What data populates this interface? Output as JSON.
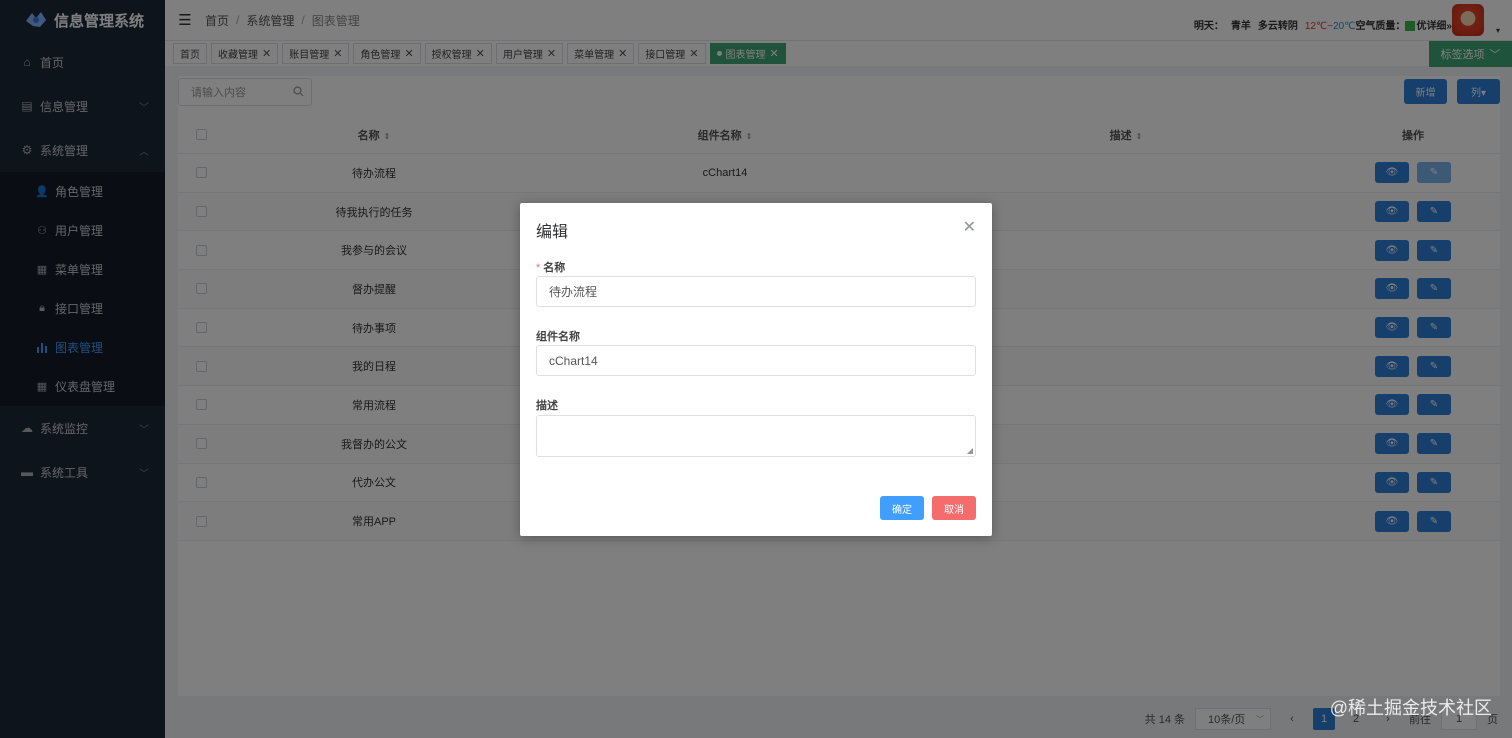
{
  "app": {
    "title": "信息管理系统"
  },
  "sidebar": {
    "items": [
      {
        "label": "首页",
        "icon": "home-icon"
      },
      {
        "label": "信息管理",
        "icon": "info-icon",
        "expandable": true
      },
      {
        "label": "系统管理",
        "icon": "gear-icon",
        "expandable": true,
        "expanded": true
      },
      {
        "label": "系统监控",
        "icon": "monitor-icon",
        "expandable": true
      },
      {
        "label": "系统工具",
        "icon": "tools-icon",
        "expandable": true
      }
    ],
    "system_sub": [
      {
        "label": "角色管理",
        "icon": "user-group-icon"
      },
      {
        "label": "用户管理",
        "icon": "user-icon"
      },
      {
        "label": "菜单管理",
        "icon": "grid-icon"
      },
      {
        "label": "接口管理",
        "icon": "lock-icon"
      },
      {
        "label": "图表管理",
        "icon": "bar-chart-icon",
        "active": true
      },
      {
        "label": "仪表盘管理",
        "icon": "table-icon"
      }
    ]
  },
  "header": {
    "breadcrumb": [
      "首页",
      "系统管理",
      "图表管理"
    ],
    "weather": {
      "day": "明天：",
      "location": "青羊",
      "condition": "多云转阴",
      "temp_low": "12℃~",
      "temp_high": "20℃",
      "air": "空气质量：",
      "air_level": "优",
      "detail": "详细»"
    }
  },
  "tabs": {
    "items": [
      {
        "label": "首页",
        "closable": false
      },
      {
        "label": "收藏管理",
        "closable": true
      },
      {
        "label": "账目管理",
        "closable": true
      },
      {
        "label": "角色管理",
        "closable": true
      },
      {
        "label": "授权管理",
        "closable": true
      },
      {
        "label": "用户管理",
        "closable": true
      },
      {
        "label": "菜单管理",
        "closable": true
      },
      {
        "label": "接口管理",
        "closable": true
      },
      {
        "label": "图表管理",
        "closable": true,
        "active": true
      }
    ],
    "options_label": "标签选项"
  },
  "toolbar": {
    "search_placeholder": "请输入内容",
    "add_label": "新增",
    "columns_label": "列▾"
  },
  "table": {
    "headers": {
      "name": "名称",
      "component": "组件名称",
      "desc": "描述",
      "ops": "操作"
    },
    "rows": [
      {
        "name": "待办流程",
        "component": "cChart14",
        "desc": ""
      },
      {
        "name": "待我执行的任务",
        "component": "",
        "desc": ""
      },
      {
        "name": "我参与的会议",
        "component": "",
        "desc": ""
      },
      {
        "name": "督办提醒",
        "component": "",
        "desc": ""
      },
      {
        "name": "待办事项",
        "component": "",
        "desc": ""
      },
      {
        "name": "我的日程",
        "component": "",
        "desc": ""
      },
      {
        "name": "常用流程",
        "component": "",
        "desc": ""
      },
      {
        "name": "我督办的公文",
        "component": "",
        "desc": ""
      },
      {
        "name": "代办公文",
        "component": "",
        "desc": ""
      },
      {
        "name": "常用APP",
        "component": "",
        "desc": ""
      }
    ]
  },
  "pagination": {
    "total": "共 14 条",
    "page_size": "10条/页",
    "pages": [
      "1",
      "2"
    ],
    "current": "1",
    "goto_label": "前往",
    "goto_value": "1",
    "page_suffix": "页"
  },
  "modal": {
    "title": "编辑",
    "fields": {
      "name_label": "名称",
      "name_value": "待办流程",
      "component_label": "组件名称",
      "component_value": "cChart14",
      "desc_label": "描述",
      "desc_value": ""
    },
    "ok_label": "确定",
    "cancel_label": "取消"
  },
  "watermark": "@稀土掘金技术社区",
  "colors": {
    "sidebar_bg": "#1d2939",
    "primary": "#409eff",
    "tab_active": "#3fa676",
    "danger": "#f56c6c"
  }
}
